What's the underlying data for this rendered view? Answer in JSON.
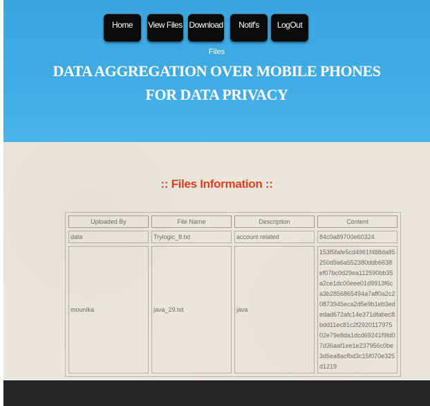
{
  "nav": {
    "home": "Home",
    "view_files": "View Files",
    "download": "Download",
    "notifs": "Notif's",
    "logout": "LogOut"
  },
  "header": {
    "subtitle": "Files",
    "title": "DATA AGGREGATION OVER MOBILE PHONES FOR DATA PRIVACY"
  },
  "main": {
    "heading": ":: Files Information ::"
  },
  "table": {
    "headers": [
      "Uploaded By",
      "File Name",
      "Description",
      "Content"
    ],
    "rows": [
      [
        "data",
        "Trylogic_8.txt",
        "account related",
        "84c0a89700e60324"
      ],
      [
        "mounika",
        "java_29.txt",
        "java",
        "153f5fafe5cd4961f488da85250d9a6a552380ddb6638ef07bc0d29ea112590bb35a2ce1dc00eee01d9913f6ca3b2856865494a7aff0a2c20873945eca2d5e9b1eb3ededad672afc14e371dfabec8bdd11ec81c2f292011797502e79e8da1dcd69241f9fd07d36aaf1ee1e237956c0be3d5ea8acfbd3c15f070e325d1219"
      ]
    ]
  },
  "colors": {
    "header_bg": "#41ace4",
    "nav_button_bg": "#0b0b0b",
    "heading_red": "#e23b1d",
    "content_bg": "#eae7dd",
    "footer_bg": "#252525"
  }
}
